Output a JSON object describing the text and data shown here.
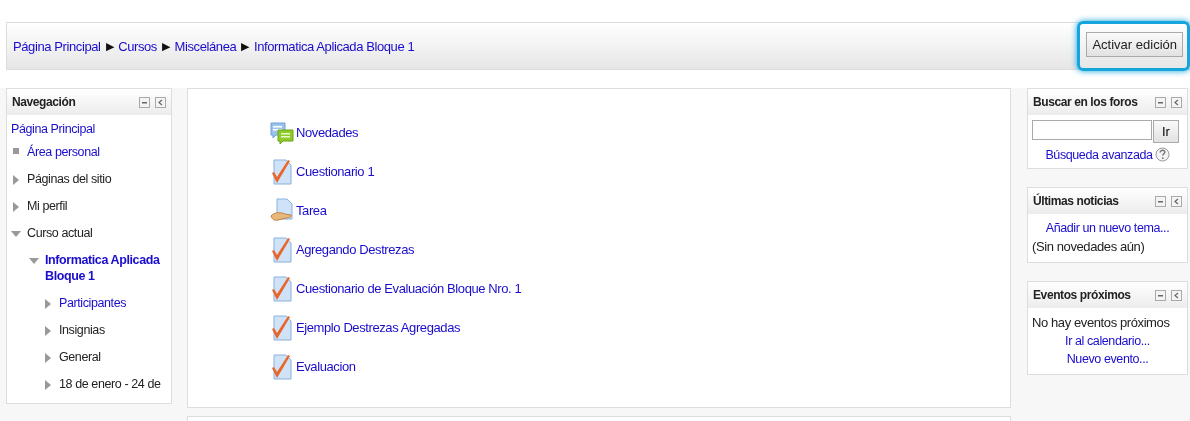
{
  "breadcrumb": [
    "Página Principal",
    "Cursos",
    "Miscelánea",
    "Informatica Aplicada Bloque 1"
  ],
  "breadcrumb_separator": "▶",
  "edit_button": {
    "label": "Activar edición",
    "highlighted": true
  },
  "navigation": {
    "title": "Navegación",
    "items": [
      {
        "kind": "root",
        "label": "Página Principal",
        "link": true,
        "current": false,
        "children": [
          {
            "kind": "leaf",
            "label": "Área personal",
            "link": true,
            "current": false
          },
          {
            "kind": "branch",
            "label": "Páginas del sitio",
            "link": false,
            "expanded": false,
            "current": false
          },
          {
            "kind": "branch",
            "label": "Mi perfil",
            "link": false,
            "expanded": false,
            "current": false
          },
          {
            "kind": "branch",
            "label": "Curso actual",
            "link": false,
            "expanded": true,
            "current": false,
            "children": [
              {
                "kind": "branch",
                "label": "Informatica Aplicada Bloque 1",
                "link": true,
                "expanded": true,
                "current": true,
                "children": [
                  {
                    "kind": "branch",
                    "label": "Participantes",
                    "link": true,
                    "expanded": false,
                    "current": false
                  },
                  {
                    "kind": "branch",
                    "label": "Insignias",
                    "link": false,
                    "expanded": false,
                    "current": false
                  },
                  {
                    "kind": "branch",
                    "label": "General",
                    "link": false,
                    "expanded": false,
                    "current": false
                  },
                  {
                    "kind": "branch",
                    "label": "18 de enero - 24 de",
                    "link": false,
                    "expanded": false,
                    "current": false
                  }
                ]
              }
            ]
          }
        ]
      }
    ]
  },
  "activities": [
    {
      "kind": "forum",
      "label": "Novedades"
    },
    {
      "kind": "quiz",
      "label": "Cuestionario 1"
    },
    {
      "kind": "assignment",
      "label": "Tarea"
    },
    {
      "kind": "quiz",
      "label": "Agregando Destrezas"
    },
    {
      "kind": "quiz",
      "label": "Cuestionario de Evaluación Bloque Nro. 1"
    },
    {
      "kind": "quiz",
      "label": "Ejemplo Destrezas Agregadas"
    },
    {
      "kind": "quiz",
      "label": "Evaluacion"
    }
  ],
  "blocks": [
    {
      "title": "Buscar en los foros",
      "content": [
        {
          "kind": "search",
          "button": "Ir"
        },
        {
          "kind": "help-link",
          "text": "Búsqueda avanzada"
        }
      ]
    },
    {
      "title": "Últimas noticias",
      "content": [
        {
          "kind": "link",
          "text": "Añadir un nuevo tema..."
        },
        {
          "kind": "text",
          "text": "(Sin novedades aún)"
        }
      ]
    },
    {
      "title": "Eventos próximos",
      "content": [
        {
          "kind": "text",
          "text": "No hay eventos próximos"
        },
        {
          "kind": "link",
          "text": "Ir al calendario..."
        },
        {
          "kind": "link",
          "text": "Nuevo evento..."
        }
      ]
    }
  ]
}
